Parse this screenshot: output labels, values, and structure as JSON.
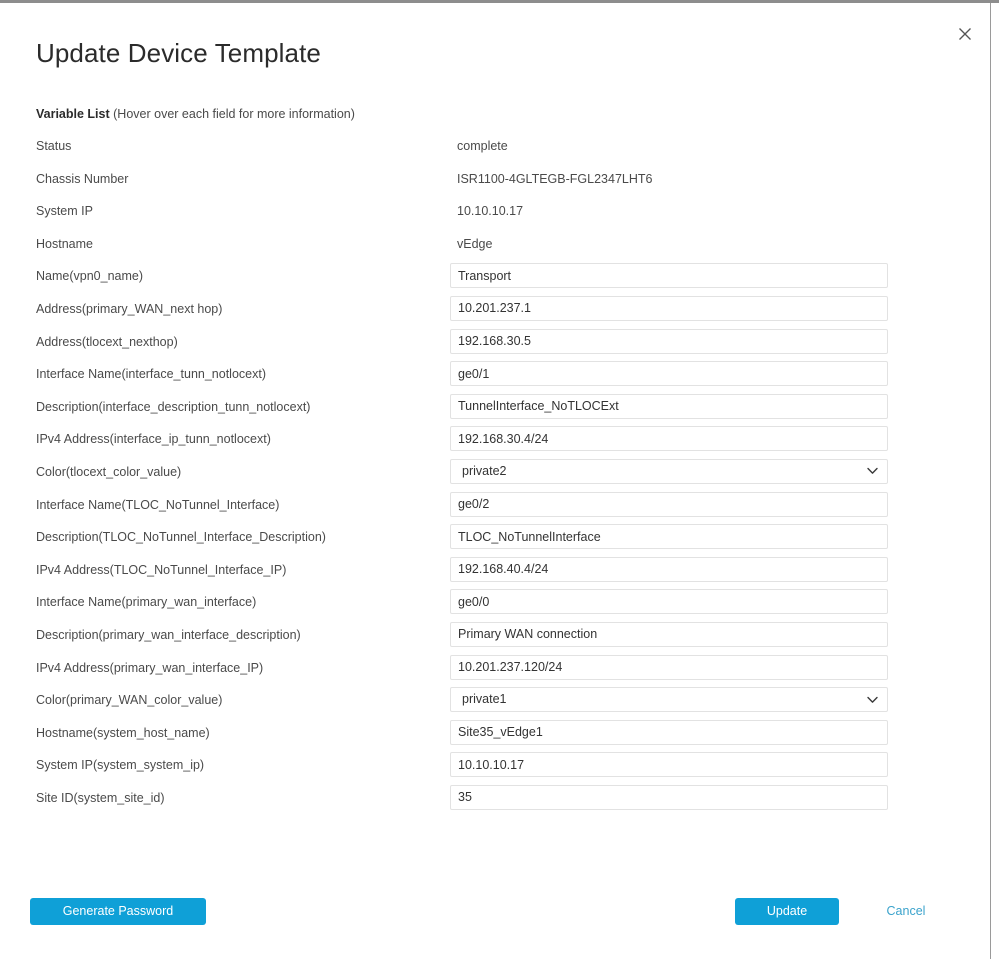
{
  "dialog": {
    "title": "Update Device Template",
    "close_icon": "close-icon",
    "variable_list_label": "Variable List",
    "variable_list_hint": "(Hover over each field for more information)"
  },
  "accent_colors": {
    "primary_button": "#0fa0d7",
    "cancel_link": "#3ba3cc",
    "input_border": "#e2e2e2",
    "label_text": "#4a4a4a"
  },
  "rows": [
    {
      "label": "Status",
      "type": "static",
      "value": "complete"
    },
    {
      "label": "Chassis Number",
      "type": "static",
      "value": "ISR1100-4GLTEGB-FGL2347LHT6"
    },
    {
      "label": "System IP",
      "type": "static",
      "value": "10.10.10.17"
    },
    {
      "label": "Hostname",
      "type": "static",
      "value": "vEdge"
    },
    {
      "label": "Name(vpn0_name)",
      "type": "input",
      "value": "Transport"
    },
    {
      "label": "Address(primary_WAN_next hop)",
      "type": "input",
      "value": "10.201.237.1"
    },
    {
      "label": "Address(tlocext_nexthop)",
      "type": "input",
      "value": "192.168.30.5"
    },
    {
      "label": "Interface Name(interface_tunn_notlocext)",
      "type": "input",
      "value": "ge0/1"
    },
    {
      "label": "Description(interface_description_tunn_notlocext)",
      "type": "input",
      "value": "TunnelInterface_NoTLOCExt"
    },
    {
      "label": "IPv4 Address(interface_ip_tunn_notlocext)",
      "type": "input",
      "value": "192.168.30.4/24"
    },
    {
      "label": "Color(tlocext_color_value)",
      "type": "select",
      "value": "private2"
    },
    {
      "label": "Interface Name(TLOC_NoTunnel_Interface)",
      "type": "input",
      "value": "ge0/2"
    },
    {
      "label": "Description(TLOC_NoTunnel_Interface_Description)",
      "type": "input",
      "value": "TLOC_NoTunnelInterface"
    },
    {
      "label": "IPv4 Address(TLOC_NoTunnel_Interface_IP)",
      "type": "input",
      "value": "192.168.40.4/24"
    },
    {
      "label": "Interface Name(primary_wan_interface)",
      "type": "input",
      "value": "ge0/0"
    },
    {
      "label": "Description(primary_wan_interface_description)",
      "type": "input",
      "value": "Primary WAN connection"
    },
    {
      "label": "IPv4 Address(primary_wan_interface_IP)",
      "type": "input",
      "value": "10.201.237.120/24"
    },
    {
      "label": "Color(primary_WAN_color_value)",
      "type": "select",
      "value": "private1"
    },
    {
      "label": "Hostname(system_host_name)",
      "type": "input",
      "value": "Site35_vEdge1"
    },
    {
      "label": "System IP(system_system_ip)",
      "type": "input",
      "value": "10.10.10.17"
    },
    {
      "label": "Site ID(system_site_id)",
      "type": "input",
      "value": "35"
    }
  ],
  "footer": {
    "generate_password_label": "Generate Password",
    "update_label": "Update",
    "cancel_label": "Cancel"
  }
}
